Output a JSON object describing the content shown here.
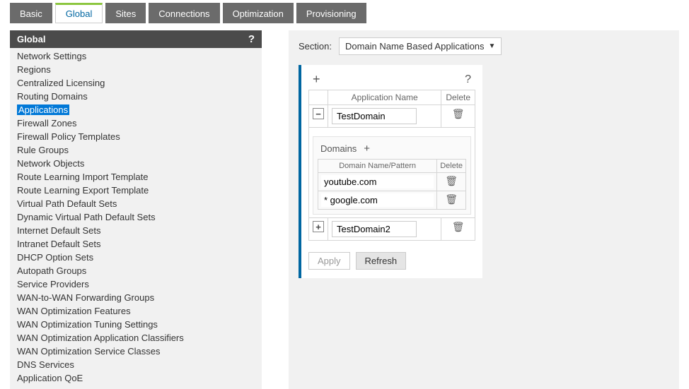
{
  "tabs": [
    "Basic",
    "Global",
    "Sites",
    "Connections",
    "Optimization",
    "Provisioning"
  ],
  "active_tab": "Global",
  "sidebar": {
    "title": "Global",
    "items": [
      "Network Settings",
      "Regions",
      "Centralized Licensing",
      "Routing Domains",
      "Applications",
      "Firewall Zones",
      "Firewall Policy Templates",
      "Rule Groups",
      "Network Objects",
      "Route Learning Import Template",
      "Route Learning Export Template",
      "Virtual Path Default Sets",
      "Dynamic Virtual Path Default Sets",
      "Internet Default Sets",
      "Intranet Default Sets",
      "DHCP Option Sets",
      "Autopath Groups",
      "Service Providers",
      "WAN-to-WAN Forwarding Groups",
      "WAN Optimization Features",
      "WAN Optimization Tuning Settings",
      "WAN Optimization Application Classifiers",
      "WAN Optimization Service Classes",
      "DNS Services",
      "Application QoE"
    ],
    "selected": "Applications"
  },
  "section": {
    "label": "Section:",
    "value": "Domain Name Based Applications"
  },
  "panel": {
    "add_icon": "+",
    "help_icon": "?",
    "columns": {
      "name": "Application Name",
      "delete": "Delete"
    },
    "rows": [
      {
        "expanded": true,
        "toggle": "−",
        "name": "TestDomain",
        "domains_label": "Domains",
        "domain_columns": {
          "name": "Domain Name/Pattern",
          "delete": "Delete"
        },
        "domains": [
          {
            "pattern": "youtube.com"
          },
          {
            "pattern": "* google.com"
          }
        ]
      },
      {
        "expanded": false,
        "toggle": "+",
        "name": "TestDomain2"
      }
    ]
  },
  "actions": {
    "apply": "Apply",
    "refresh": "Refresh"
  },
  "glyph": {
    "trash": "🗑",
    "dropdown": "▼"
  }
}
